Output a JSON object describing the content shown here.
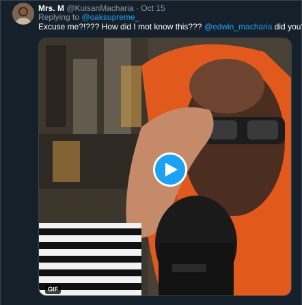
{
  "tweet": {
    "name": "Mrs. M",
    "handle": "@KuisanMacharia",
    "separator": "·",
    "date": "Oct 15",
    "replying_prefix": "Replying to",
    "replying_handle": "@oaksupreme_",
    "text_part1": "Excuse me?!??? How did I mot know this???",
    "mention": "@edwin_macharia",
    "text_part2": "did you?!?"
  },
  "media": {
    "badge": "GIF",
    "play_icon": "play-icon",
    "accent": "#1da1f2"
  }
}
